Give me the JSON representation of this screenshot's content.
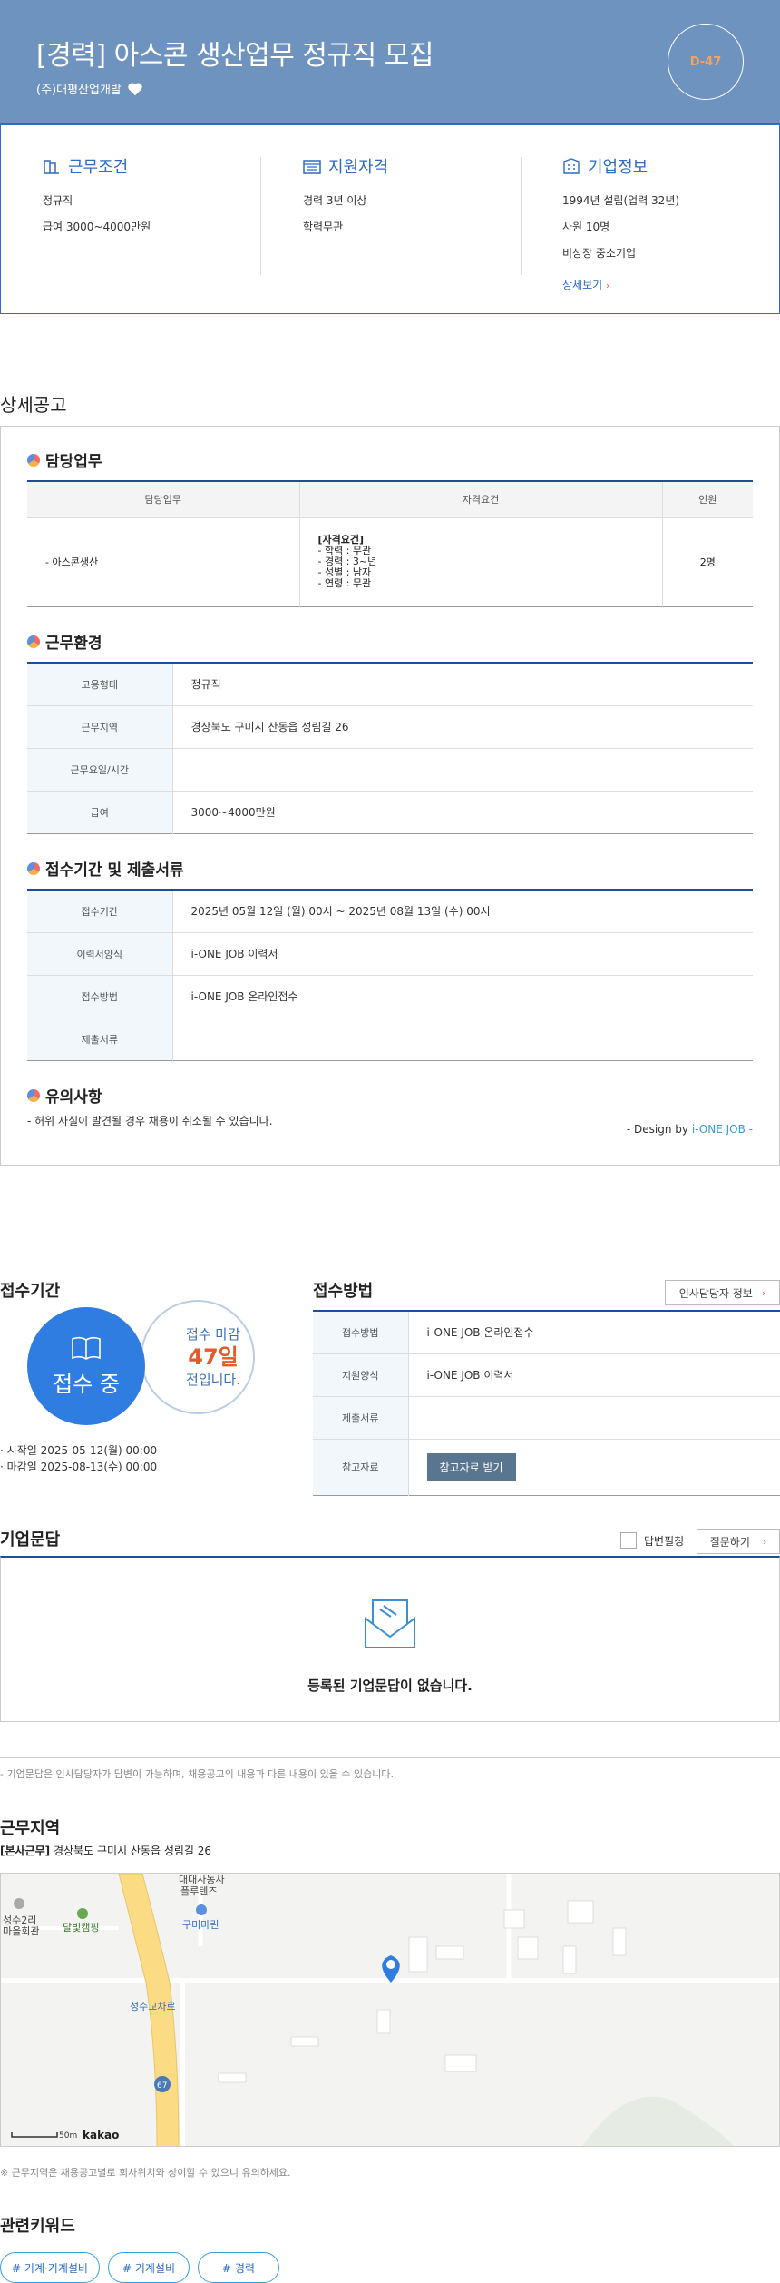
{
  "header": {
    "title": "[경력] 아스콘 생산업무 정규직 모집",
    "company": "(주)대평산업개발",
    "dday": "D-47"
  },
  "summary": {
    "work": {
      "title": "근무조건",
      "items": [
        "정규직",
        "급여 3000~4000만원"
      ]
    },
    "qual": {
      "title": "지원자격",
      "items": [
        "경력 3년 이상",
        "학력무관"
      ]
    },
    "company": {
      "title": "기업정보",
      "items": [
        "1994년 설립(업력 32년)",
        "사원 10명",
        "비상장 중소기업"
      ],
      "more": "상세보기"
    }
  },
  "detail": {
    "section_title": "상세공고",
    "duty": {
      "title": "담당업무",
      "headers": [
        "담당업무",
        "자격요건",
        "인원"
      ],
      "row": {
        "duty": "- 아스콘생산",
        "qual_title": "[자격요건]",
        "qual_items": [
          "- 학력 : 무관",
          "- 경력 : 3~년",
          "- 성별 : 남자",
          "- 연령 : 무관"
        ],
        "count": "2명"
      }
    },
    "env": {
      "title": "근무환경",
      "rows": [
        {
          "k": "고용형태",
          "v": "정규직"
        },
        {
          "k": "근무지역",
          "v": "경상북도 구미시 산동읍 성림길 26"
        },
        {
          "k": "근무요일/시간",
          "v": ""
        },
        {
          "k": "급여",
          "v": "3000~4000만원"
        }
      ]
    },
    "period": {
      "title": "접수기간 및 제출서류",
      "rows": [
        {
          "k": "접수기간",
          "v": "2025년 05월 12일 (월) 00시 ~ 2025년 08월 13일 (수) 00시"
        },
        {
          "k": "이력서양식",
          "v": "i-ONE JOB 이력서"
        },
        {
          "k": "접수방법",
          "v": "i-ONE JOB 온라인접수"
        },
        {
          "k": "제출서류",
          "v": ""
        }
      ]
    },
    "notice": {
      "title": "유의사항",
      "text": "- 허위 사실이 발견될 경우 채용이 취소될 수 있습니다."
    },
    "design": {
      "prefix": "- Design by ",
      "brand": "i-ONE JOB -"
    }
  },
  "apply": {
    "period_title": "접수기간",
    "status": "접수 중",
    "deadline_label": "접수 마감",
    "days": "47일",
    "days_suffix": "전입니다.",
    "start": "시작일 2025-05-12(월) 00:00",
    "end": "마감일 2025-08-13(수) 00:00",
    "method_title": "접수방법",
    "hr_button": "인사담당자 정보",
    "rows": [
      {
        "k": "접수방법",
        "v": "i-ONE JOB 온라인접수"
      },
      {
        "k": "지원양식",
        "v": "i-ONE JOB 이력서"
      },
      {
        "k": "제출서류",
        "v": ""
      },
      {
        "k": "참고자료",
        "v": ""
      }
    ],
    "ref_button": "참고자료 받기"
  },
  "qa": {
    "title": "기업문답",
    "checkbox_label": "답변필칭",
    "ask_button": "질문하기",
    "empty": "등록된 기업문답이 없습니다.",
    "note": "- 기업문답은 인사담당자가 답변이 가능하며, 채용공고의 내용과 다른 내용이 있을 수 있습니다."
  },
  "location": {
    "title": "근무지역",
    "tag": "[본사근무]",
    "address": "경상북도 구미시 산동읍 성림길 26",
    "map_labels": {
      "hall": "성수2리\n마을회관",
      "camp": "달빛캠핑",
      "plant": "대대사농사\n플루텐즈",
      "marina": "구미마린",
      "bridge": "성수교차로",
      "road": "67",
      "scale": "50m",
      "brand": "kakao"
    },
    "note": "※ 근무지역은 채용공고별로 회사위치와 상이할 수 있으니 유의하세요."
  },
  "keywords": {
    "title": "관련키워드",
    "items": [
      "# 기계·기계설비",
      "# 기계설비",
      "# 경력"
    ]
  }
}
